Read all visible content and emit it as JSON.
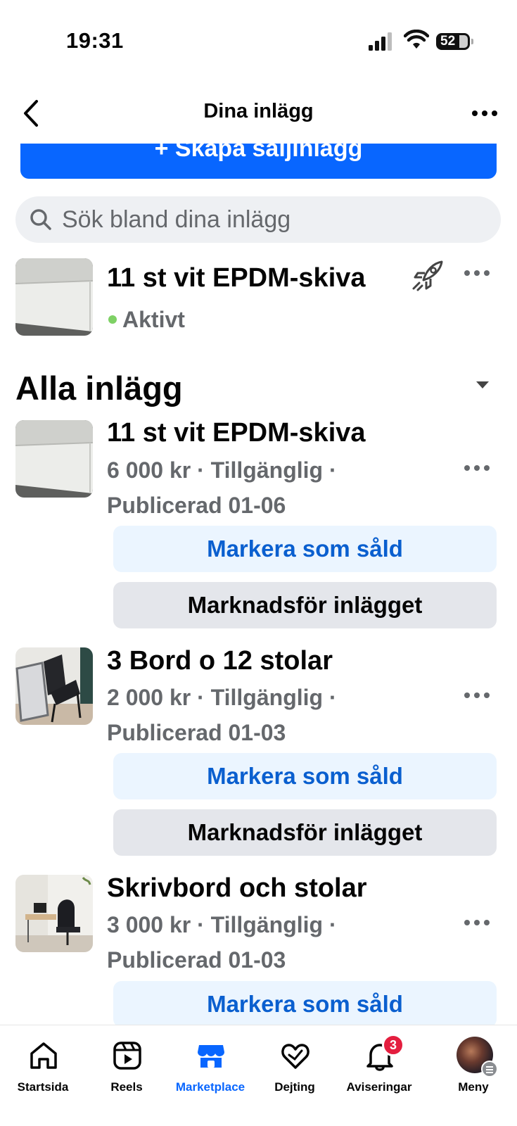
{
  "status_bar": {
    "time": "19:31",
    "battery": "52"
  },
  "header": {
    "title": "Dina inlägg",
    "back_icon": "chevron-left-icon",
    "more_icon": "more-horizontal-icon"
  },
  "create_button": {
    "label": "+ Skapa säljinlägg",
    "color": "#0866ff"
  },
  "search": {
    "placeholder": "Sök bland dina inlägg"
  },
  "featured": {
    "title": "11 st vit EPDM-skiva",
    "status": "Aktivt",
    "status_color": "#7ed165"
  },
  "section": {
    "title": "Alla inlägg"
  },
  "listings": [
    {
      "title": "11 st vit EPDM-skiva",
      "price_status": "6 000 kr · Tillgänglig ·",
      "published": "Publicerad 01-06",
      "mark_sold": "Markera som såld",
      "promote": "Marknadsför inlägget"
    },
    {
      "title": "3 Bord o 12 stolar",
      "price_status": "2 000 kr · Tillgänglig ·",
      "published": "Publicerad 01-03",
      "mark_sold": "Markera som såld",
      "promote": "Marknadsför inlägget"
    },
    {
      "title": "Skrivbord och stolar",
      "price_status": "3 000 kr · Tillgänglig ·",
      "published": "Publicerad 01-03",
      "mark_sold": "Markera som såld"
    }
  ],
  "tabbar": {
    "items": [
      {
        "label": "Startsida",
        "icon": "home-icon"
      },
      {
        "label": "Reels",
        "icon": "reels-icon"
      },
      {
        "label": "Marketplace",
        "icon": "marketplace-icon",
        "active": true
      },
      {
        "label": "Dejting",
        "icon": "heart-icon"
      },
      {
        "label": "Aviseringar",
        "icon": "bell-icon",
        "badge": "3"
      },
      {
        "label": "Meny",
        "icon": "avatar"
      }
    ]
  }
}
